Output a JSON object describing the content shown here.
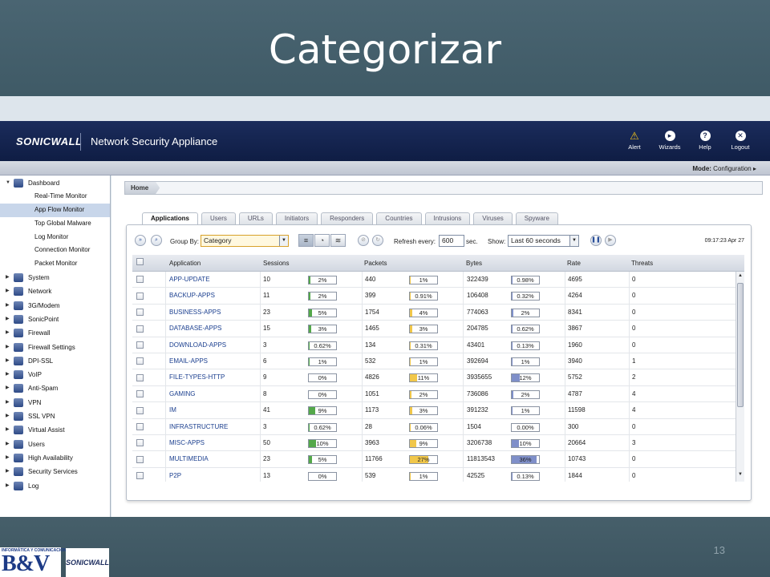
{
  "slide": {
    "title": "Categorizar",
    "number": "13"
  },
  "footer": {
    "bv_small": "INFORMÁTICA Y COMUNICACIONES",
    "bv_big": "B&V",
    "sonicwall_small": "SONICWALL"
  },
  "header": {
    "brand": "SONICWALL",
    "product": "Network Security Appliance",
    "nav": [
      {
        "label": "Alert",
        "icon": "alert-icon"
      },
      {
        "label": "Wizards",
        "icon": "wizards-icon"
      },
      {
        "label": "Help",
        "icon": "help-icon"
      },
      {
        "label": "Logout",
        "icon": "logout-icon"
      }
    ],
    "mode_label": "Mode:",
    "mode_value": "Configuration ▸"
  },
  "sidebar": {
    "dashboard": "Dashboard",
    "dashboard_subitems": [
      "Real-Time Monitor",
      "App Flow Monitor",
      "Top Global Malware",
      "Log Monitor",
      "Connection Monitor",
      "Packet Monitor"
    ],
    "active_subitem": 1,
    "items": [
      "System",
      "Network",
      "3G/Modem",
      "SonicPoint",
      "Firewall",
      "Firewall Settings",
      "DPI-SSL",
      "VoIP",
      "Anti-Spam",
      "VPN",
      "SSL VPN",
      "Virtual Assist",
      "Users",
      "High Availability",
      "Security Services",
      "Log"
    ]
  },
  "breadcrumb": {
    "home": "Home"
  },
  "tabs": [
    "Applications",
    "Users",
    "URLs",
    "Initiators",
    "Responders",
    "Countries",
    "Intrusions",
    "Viruses",
    "Spyware"
  ],
  "active_tab": 0,
  "toolbar": {
    "group_by_label": "Group By:",
    "group_by_value": "Category",
    "refresh_label": "Refresh every:",
    "refresh_value": "600",
    "refresh_unit": "sec.",
    "show_label": "Show:",
    "show_value": "Last 60 seconds",
    "timestamp": "09:17:23 Apr 27"
  },
  "table": {
    "columns": [
      "Application",
      "Sessions",
      "Packets",
      "Bytes",
      "Rate",
      "Threats"
    ],
    "rows": [
      {
        "app": "APP-UPDATE",
        "sessions": "10",
        "sessions_pct": 2,
        "packets": "440",
        "packets_pct": 1,
        "bytes": "322439",
        "bytes_pct": 0.98,
        "rate": "4695",
        "threats": "0",
        "sessions_label": "2%",
        "packets_label": "1%",
        "bytes_label": "0.98%"
      },
      {
        "app": "BACKUP-APPS",
        "sessions": "11",
        "sessions_pct": 2,
        "packets": "399",
        "packets_pct": 0.91,
        "bytes": "106408",
        "bytes_pct": 0.32,
        "rate": "4264",
        "threats": "0",
        "sessions_label": "2%",
        "packets_label": "0.91%",
        "bytes_label": "0.32%"
      },
      {
        "app": "BUSINESS-APPS",
        "sessions": "23",
        "sessions_pct": 5,
        "packets": "1754",
        "packets_pct": 4,
        "bytes": "774063",
        "bytes_pct": 2,
        "rate": "8341",
        "threats": "0",
        "sessions_label": "5%",
        "packets_label": "4%",
        "bytes_label": "2%"
      },
      {
        "app": "DATABASE-APPS",
        "sessions": "15",
        "sessions_pct": 3,
        "packets": "1465",
        "packets_pct": 3,
        "bytes": "204785",
        "bytes_pct": 0.62,
        "rate": "3867",
        "threats": "0",
        "sessions_label": "3%",
        "packets_label": "3%",
        "bytes_label": "0.62%"
      },
      {
        "app": "DOWNLOAD-APPS",
        "sessions": "3",
        "sessions_pct": 0.62,
        "packets": "134",
        "packets_pct": 0.31,
        "bytes": "43401",
        "bytes_pct": 0.13,
        "rate": "1960",
        "threats": "0",
        "sessions_label": "0.62%",
        "packets_label": "0.31%",
        "bytes_label": "0.13%"
      },
      {
        "app": "EMAIL-APPS",
        "sessions": "6",
        "sessions_pct": 1,
        "packets": "532",
        "packets_pct": 1,
        "bytes": "392694",
        "bytes_pct": 1,
        "rate": "3940",
        "threats": "1",
        "sessions_label": "1%",
        "packets_label": "1%",
        "bytes_label": "1%"
      },
      {
        "app": "FILE-TYPES-HTTP",
        "sessions": "9",
        "sessions_pct": 0,
        "packets": "4826",
        "packets_pct": 11,
        "bytes": "3935655",
        "bytes_pct": 12,
        "rate": "5752",
        "threats": "2",
        "sessions_label": "0%",
        "packets_label": "11%",
        "bytes_label": "12%"
      },
      {
        "app": "GAMING",
        "sessions": "8",
        "sessions_pct": 0,
        "packets": "1051",
        "packets_pct": 2,
        "bytes": "736086",
        "bytes_pct": 2,
        "rate": "4787",
        "threats": "4",
        "sessions_label": "0%",
        "packets_label": "2%",
        "bytes_label": "2%"
      },
      {
        "app": "IM",
        "sessions": "41",
        "sessions_pct": 9,
        "packets": "1173",
        "packets_pct": 3,
        "bytes": "391232",
        "bytes_pct": 1,
        "rate": "11598",
        "threats": "4",
        "sessions_label": "9%",
        "packets_label": "3%",
        "bytes_label": "1%"
      },
      {
        "app": "INFRASTRUCTURE",
        "sessions": "3",
        "sessions_pct": 0.62,
        "packets": "28",
        "packets_pct": 0.06,
        "bytes": "1504",
        "bytes_pct": 0,
        "rate": "300",
        "threats": "0",
        "sessions_label": "0.62%",
        "packets_label": "0.06%",
        "bytes_label": "0.00%"
      },
      {
        "app": "MISC-APPS",
        "sessions": "50",
        "sessions_pct": 10,
        "packets": "3963",
        "packets_pct": 9,
        "bytes": "3206738",
        "bytes_pct": 10,
        "rate": "20664",
        "threats": "3",
        "sessions_label": "10%",
        "packets_label": "9%",
        "bytes_label": "10%"
      },
      {
        "app": "MULTIMEDIA",
        "sessions": "23",
        "sessions_pct": 5,
        "packets": "11766",
        "packets_pct": 27,
        "bytes": "11813543",
        "bytes_pct": 36,
        "rate": "10743",
        "threats": "0",
        "sessions_label": "5%",
        "packets_label": "27%",
        "bytes_label": "36%"
      },
      {
        "app": "P2P",
        "sessions": "13",
        "sessions_pct": 0,
        "packets": "539",
        "packets_pct": 1,
        "bytes": "42525",
        "bytes_pct": 0.13,
        "rate": "1844",
        "threats": "0",
        "sessions_label": "0%",
        "packets_label": "1%",
        "bytes_label": "0.13%"
      }
    ]
  },
  "colors": {
    "sessions_bar": "#54a84a",
    "packets_bar": "#f1c74a",
    "bytes_bar": "#7f8fc9",
    "header": "#1b2c5c"
  }
}
